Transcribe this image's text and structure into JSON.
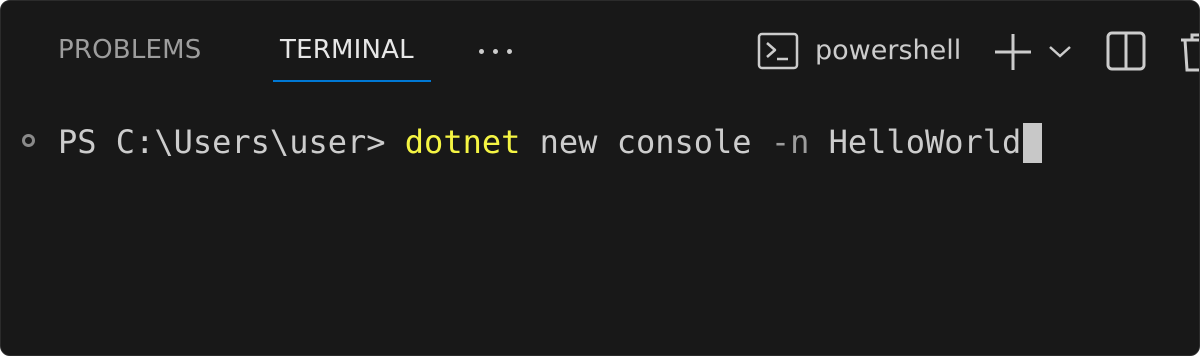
{
  "panel": {
    "tabs": [
      {
        "label": "PROBLEMS",
        "active": false
      },
      {
        "label": "TERMINAL",
        "active": true
      }
    ],
    "more_icon": "ellipsis-icon",
    "shell": {
      "icon": "terminal-powershell-icon",
      "label": "powershell"
    },
    "actions": {
      "new_terminal_icon": "plus-icon",
      "dropdown_icon": "chevron-down-icon",
      "split_icon": "split-terminal-icon",
      "kill_icon": "trash-icon"
    }
  },
  "terminal": {
    "prompt": "PS C:\\Users\\user>",
    "command": "dotnet",
    "args": "new console",
    "flag": "-n",
    "value": "HelloWorld"
  },
  "colors": {
    "background": "#181818",
    "accent": "#0078d4",
    "command": "#f5f543",
    "text": "#cccccc",
    "inactive_tab": "#9d9d9d"
  }
}
